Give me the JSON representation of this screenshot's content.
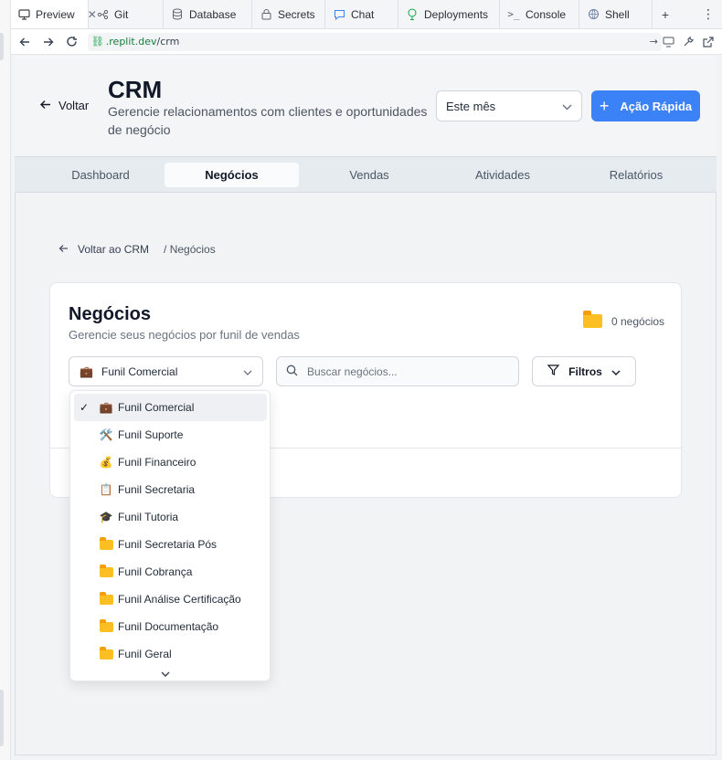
{
  "browser": {
    "tabs": [
      {
        "label": "Preview",
        "icon": "monitor-icon",
        "active": true,
        "closable": true
      },
      {
        "label": "Git",
        "icon": "git-icon"
      },
      {
        "label": "Database",
        "icon": "database-icon"
      },
      {
        "label": "Secrets",
        "icon": "lock-icon"
      },
      {
        "label": "Chat",
        "icon": "chat-icon"
      },
      {
        "label": "Deployments",
        "icon": "deploy-icon"
      },
      {
        "label": "Console",
        "icon": "terminal-icon"
      },
      {
        "label": "Shell",
        "icon": "shell-icon"
      }
    ],
    "url_host": ".replit.dev",
    "url_path": "/crm"
  },
  "header": {
    "back_label": "Voltar",
    "title": "CRM",
    "subtitle": "Gerencie relacionamentos com clientes e oportunidades de negócio",
    "period_value": "Este mês",
    "quick_action_label": "Ação Rápida"
  },
  "nav": {
    "tabs": [
      "Dashboard",
      "Negócios",
      "Vendas",
      "Atividades",
      "Relatórios"
    ],
    "active": "Negócios"
  },
  "breadcrumb": {
    "back_link": "Voltar ao CRM",
    "current": "/ Negócios"
  },
  "card": {
    "title": "Negócios",
    "subtitle": "Gerencie seus negócios por funil de vendas",
    "count_label": "0 negócios",
    "selected_funnel": "Funil Comercial",
    "search_placeholder": "Buscar negócios...",
    "filters_label": "Filtros"
  },
  "dropdown": {
    "options": [
      {
        "label": "Funil Comercial",
        "emoji": "💼",
        "selected": true
      },
      {
        "label": "Funil Suporte",
        "emoji": "🛠️"
      },
      {
        "label": "Funil Financeiro",
        "emoji": "💰"
      },
      {
        "label": "Funil Secretaria",
        "emoji": "📋"
      },
      {
        "label": "Funil Tutoria",
        "emoji": "🎓"
      },
      {
        "label": "Funil Secretaria Pós",
        "emoji": "folder"
      },
      {
        "label": "Funil Cobrança",
        "emoji": "folder"
      },
      {
        "label": "Funil Análise Certificação",
        "emoji": "folder"
      },
      {
        "label": "Funil Documentação",
        "emoji": "folder"
      },
      {
        "label": "Funil Geral",
        "emoji": "folder"
      }
    ]
  },
  "colors": {
    "primary": "#3b82f6",
    "folder": "#fbbf24"
  }
}
